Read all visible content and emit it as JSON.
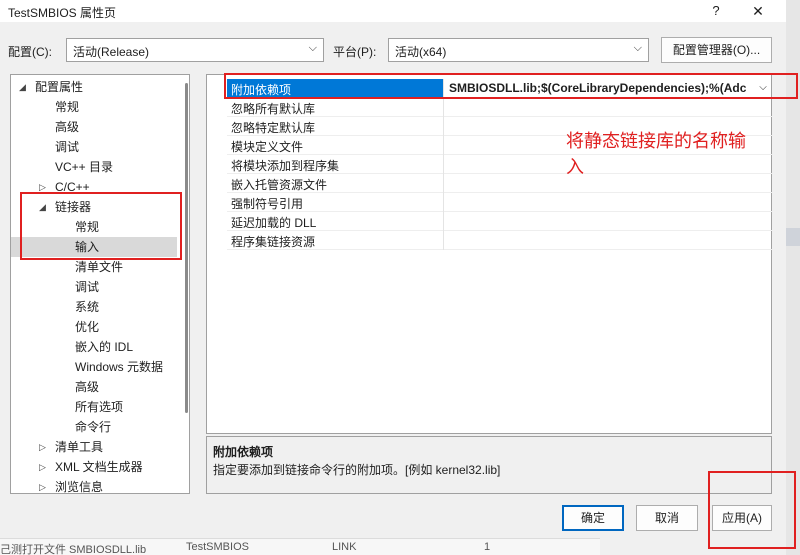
{
  "window": {
    "title": "TestSMBIOS 属性页",
    "help_glyph": "?",
    "close_glyph": "✕"
  },
  "config_bar": {
    "config_label": "配置(C):",
    "config_value": "活动(Release)",
    "platform_label": "平台(P):",
    "platform_value": "活动(x64)",
    "manager_button": "配置管理器(O)..."
  },
  "tree": {
    "items": [
      {
        "label": "配置属性",
        "arrow": "◢"
      },
      {
        "label": "常规"
      },
      {
        "label": "高级"
      },
      {
        "label": "调试"
      },
      {
        "label": "VC++ 目录"
      },
      {
        "label": "C/C++",
        "arrow": "▷"
      },
      {
        "label": "链接器",
        "arrow": "◢"
      },
      {
        "label": "常规"
      },
      {
        "label": "输入"
      },
      {
        "label": "清单文件"
      },
      {
        "label": "调试"
      },
      {
        "label": "系统"
      },
      {
        "label": "优化"
      },
      {
        "label": "嵌入的 IDL"
      },
      {
        "label": "Windows 元数据"
      },
      {
        "label": "高级"
      },
      {
        "label": "所有选项"
      },
      {
        "label": "命令行"
      },
      {
        "label": "清单工具",
        "arrow": "▷"
      },
      {
        "label": "XML 文档生成器",
        "arrow": "▷"
      },
      {
        "label": "浏览信息",
        "arrow": "▷"
      }
    ]
  },
  "properties": {
    "rows": [
      {
        "name": "附加依赖项",
        "value": "SMBIOSDLL.lib;$(CoreLibraryDependencies);%(Adc"
      },
      {
        "name": "忽略所有默认库",
        "value": ""
      },
      {
        "name": "忽略特定默认库",
        "value": ""
      },
      {
        "name": "模块定义文件",
        "value": ""
      },
      {
        "name": "将模块添加到程序集",
        "value": ""
      },
      {
        "name": "嵌入托管资源文件",
        "value": ""
      },
      {
        "name": "强制符号引用",
        "value": ""
      },
      {
        "name": "延迟加载的 DLL",
        "value": ""
      },
      {
        "name": "程序集链接资源",
        "value": ""
      }
    ],
    "dropdown_glyph": "⌵"
  },
  "description": {
    "title": "附加依赖项",
    "text": "指定要添加到链接命令行的附加项。[例如 kernel32.lib]"
  },
  "buttons": {
    "ok": "确定",
    "cancel": "取消",
    "apply": "应用(A)"
  },
  "background_row": {
    "col1": "己测打开文件 SMBIOSDLL.lib",
    "col2": "TestSMBIOS",
    "col3": "LINK",
    "col4": "1"
  },
  "annotation": {
    "text_line1": "将静态链接库的名称输",
    "text_line2": "入",
    "color": "#e02020"
  }
}
